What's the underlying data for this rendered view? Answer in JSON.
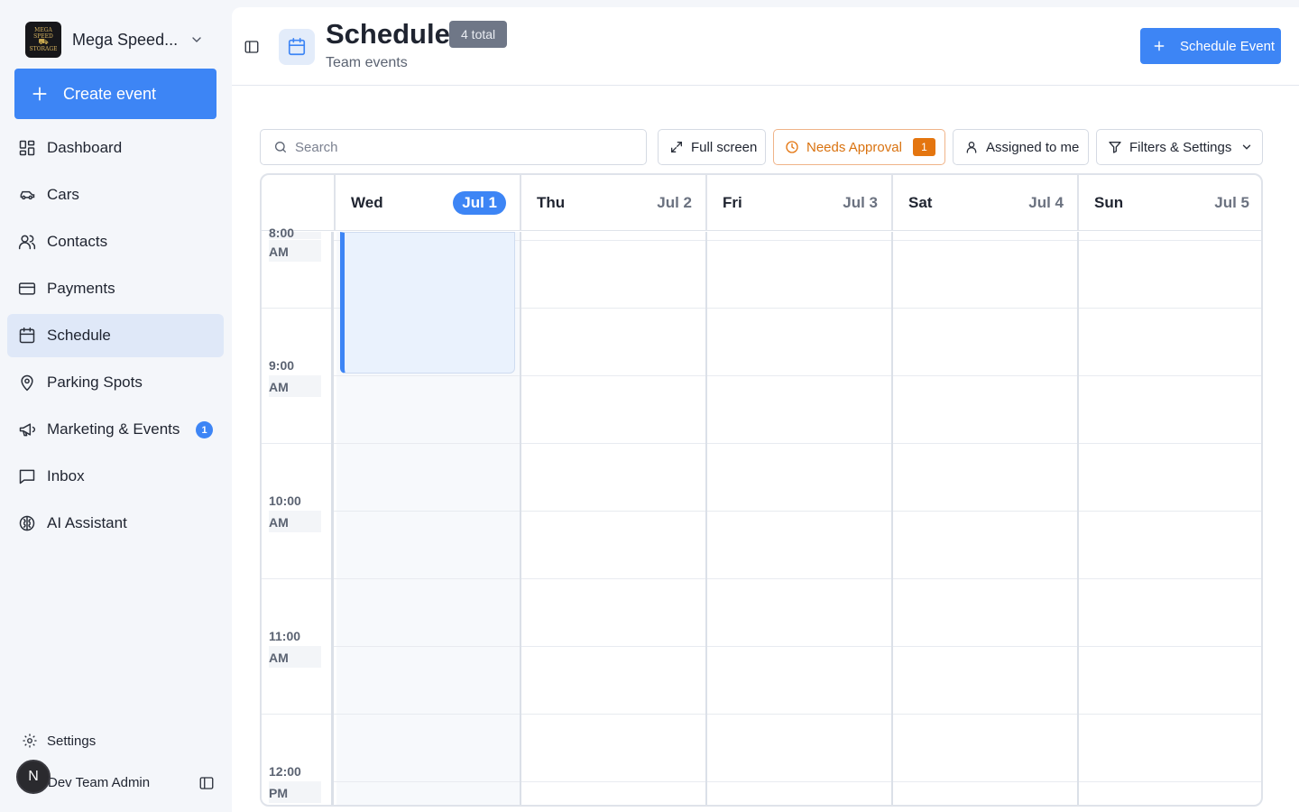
{
  "org": {
    "name": "Mega Speed...",
    "logo_lines": [
      "MEGA SPEED",
      "STORAGE"
    ]
  },
  "sidebar": {
    "create_label": "Create event",
    "items": [
      {
        "label": "Dashboard",
        "icon": "dashboard-icon"
      },
      {
        "label": "Cars",
        "icon": "car-icon"
      },
      {
        "label": "Contacts",
        "icon": "contacts-icon"
      },
      {
        "label": "Payments",
        "icon": "credit-card-icon"
      },
      {
        "label": "Schedule",
        "icon": "calendar-icon",
        "active": true
      },
      {
        "label": "Parking Spots",
        "icon": "map-pin-icon"
      },
      {
        "label": "Marketing & Events",
        "icon": "megaphone-icon",
        "badge": "1"
      },
      {
        "label": "Inbox",
        "icon": "message-square-icon"
      },
      {
        "label": "AI Assistant",
        "icon": "brain-icon"
      }
    ],
    "settings_label": "Settings",
    "user": {
      "initial": "N",
      "name": "Dev Team Admin"
    }
  },
  "header": {
    "title": "Schedule",
    "badge": "4 total",
    "subtitle": "Team events",
    "schedule_button": "Schedule Event"
  },
  "toolbar": {
    "search_placeholder": "Search",
    "full_screen": "Full screen",
    "needs_approval": "Needs Approval",
    "needs_approval_count": "1",
    "assigned_to_me": "Assigned to me",
    "filters": "Filters & Settings"
  },
  "calendar": {
    "days": [
      {
        "day": "Wed",
        "date": "Jul 1",
        "today": true
      },
      {
        "day": "Thu",
        "date": "Jul 2"
      },
      {
        "day": "Fri",
        "date": "Jul 3"
      },
      {
        "day": "Sat",
        "date": "Jul 4"
      },
      {
        "day": "Sun",
        "date": "Jul 5"
      }
    ],
    "times": [
      {
        "hour": "8:00",
        "period": "AM"
      },
      {
        "hour": "9:00",
        "period": "AM"
      },
      {
        "hour": "10:00",
        "period": "AM"
      },
      {
        "hour": "11:00",
        "period": "AM"
      },
      {
        "hour": "12:00",
        "period": "PM"
      }
    ]
  },
  "colors": {
    "accent": "#3d85f5",
    "approval": "#e4750f",
    "active_nav": "#dfe8f8"
  }
}
